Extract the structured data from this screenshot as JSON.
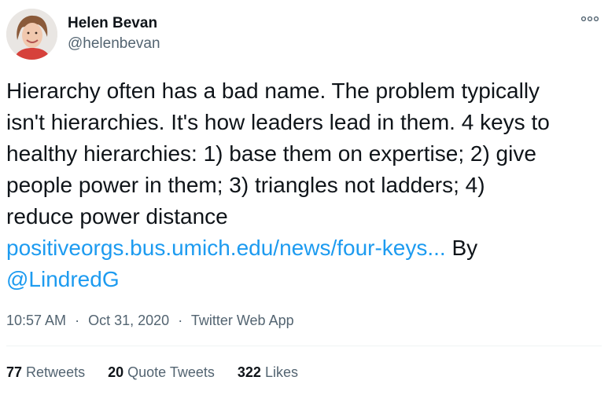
{
  "author": {
    "name": "Helen Bevan",
    "handle": "@helenbevan"
  },
  "tweet": {
    "text_line1": "Hierarchy often has a bad name. The problem typically",
    "text_line2": "isn't hierarchies. It's how leaders lead in them. 4 keys to",
    "text_line3": "healthy hierarchies: 1) base them on expertise; 2) give",
    "text_line4": "people power in them; 3) triangles not ladders; 4)",
    "text_line5": "reduce power distance",
    "link": "positiveorgs.bus.umich.edu/news/four-keys...",
    "by_text": " By",
    "mention": "@LindredG"
  },
  "meta": {
    "time": "10:57 AM",
    "date": "Oct 31, 2020",
    "source": "Twitter Web App",
    "separator": "·"
  },
  "stats": {
    "retweets_count": "77",
    "retweets_label": "Retweets",
    "quotes_count": "20",
    "quotes_label": "Quote Tweets",
    "likes_count": "322",
    "likes_label": "Likes"
  },
  "icons": {
    "more": "more-horizontal-icon"
  },
  "colors": {
    "link": "#1d9bf0",
    "secondary_text": "#536471",
    "primary_text": "#0f1419"
  }
}
